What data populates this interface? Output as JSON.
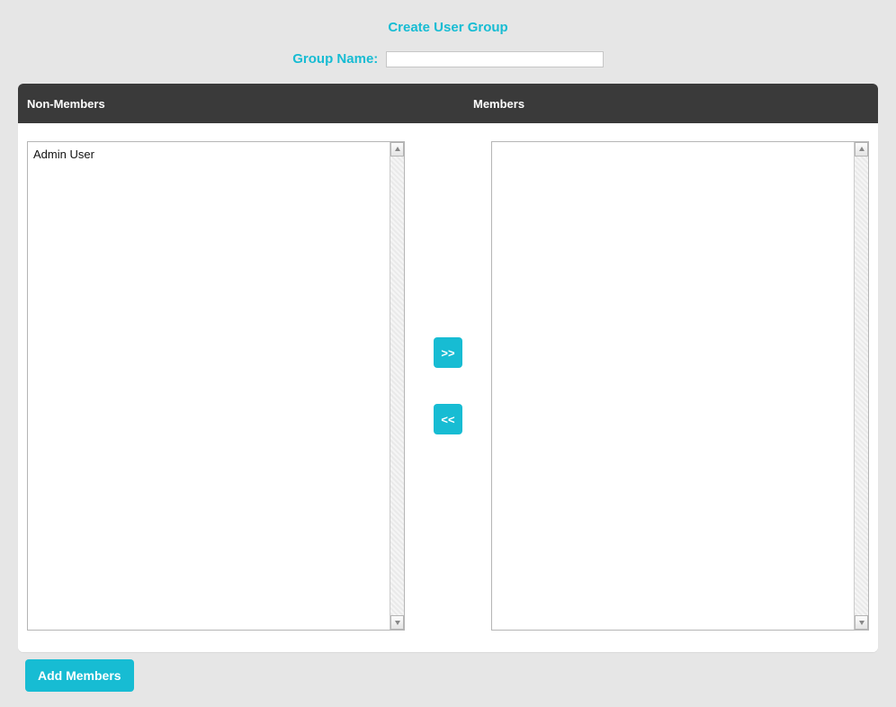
{
  "page": {
    "title": "Create User Group",
    "group_name_label": "Group Name:",
    "group_name_value": ""
  },
  "columns": {
    "non_members": "Non-Members",
    "members": "Members"
  },
  "transfer": {
    "to_members": ">>",
    "to_nonmembers": "<<"
  },
  "non_members_list": [
    "Admin User"
  ],
  "members_list": [],
  "actions": {
    "add_members": "Add Members"
  }
}
